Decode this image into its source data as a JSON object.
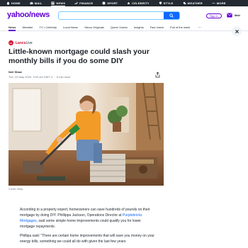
{
  "topnav": {
    "items": [
      {
        "label": "HOME",
        "icon": "home-icon"
      },
      {
        "label": "MAIL",
        "icon": "mail-icon"
      },
      {
        "label": "NEWS",
        "icon": "news-icon"
      },
      {
        "label": "FINANCE",
        "icon": "finance-icon"
      },
      {
        "label": "SPORT",
        "icon": "sport-icon"
      },
      {
        "label": "CELEBRITY",
        "icon": "celebrity-icon"
      },
      {
        "label": "STYLE",
        "icon": "style-icon"
      },
      {
        "label": "WEATHER",
        "icon": "weather-icon"
      },
      {
        "label": "MORE",
        "icon": "more-icon"
      }
    ]
  },
  "header": {
    "logo": "yahoo/news",
    "search_placeholder": "",
    "signin_label": "Sign in",
    "mail_label": "Mail"
  },
  "subnav": {
    "items": [
      "News",
      "Weather",
      "TV • Celebrity",
      "Local News",
      "Yahoo Originals",
      "Queer Voices",
      "Insights",
      "Fact check",
      "Poll of the week"
    ],
    "more": "…"
  },
  "article": {
    "source_badge": "LL",
    "source_name_bold": "Lancs",
    "source_name_rest": "Live",
    "title": "Little-known mortgage could slash your monthly bills if you do some DIY",
    "author": "Neil Shaw",
    "date": "Tue, 20 May 2025, 3:09 am GMT-4",
    "read_time": "6 min read",
    "photo_credit": "Credit: Getty",
    "para1_before": "According to a property expert, homeowners can save hundreds of pounds on their mortgage by doing DIY. Phillippa Jackson, Operations Director at ",
    "para1_link": "Purplebricks Mortgages",
    "para1_after": ", said some simple home improvements could qualify you for lower mortgage repayments.",
    "para2": "Phillipa said: \"There are certain home improvements that will save you money on your energy bills, something we could all do with given the last few years"
  },
  "colors": {
    "brand": "#6001d2",
    "search_button": "#0f69ff",
    "topnav_bg": "#232a31",
    "link": "#0f69ff"
  }
}
